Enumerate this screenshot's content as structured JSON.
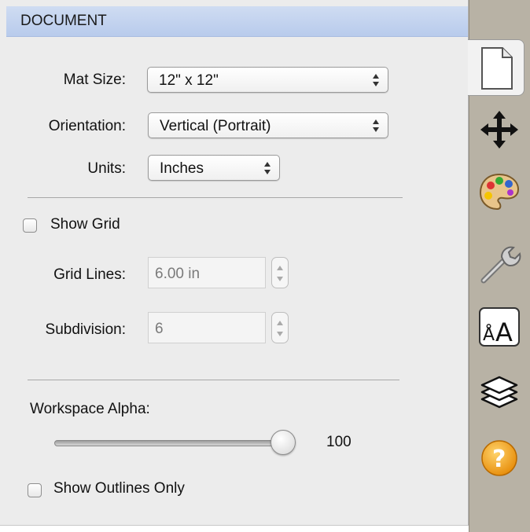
{
  "header": {
    "title": "DOCUMENT"
  },
  "mat_size": {
    "label": "Mat Size:",
    "value": "12\" x 12\""
  },
  "orientation": {
    "label": "Orientation:",
    "value": "Vertical (Portrait)"
  },
  "units": {
    "label": "Units:",
    "value": "Inches"
  },
  "show_grid": {
    "label": "Show Grid",
    "checked": false
  },
  "grid_lines": {
    "label": "Grid Lines:",
    "value": "6.00 in"
  },
  "subdivision": {
    "label": "Subdivision:",
    "value": "6"
  },
  "workspace_alpha": {
    "label": "Workspace Alpha:",
    "value": "100",
    "level": 1.0
  },
  "show_outlines": {
    "label": "Show Outlines Only",
    "checked": false
  },
  "sidebar": {
    "tabs": [
      {
        "name": "document-icon",
        "active": true
      },
      {
        "name": "move-icon",
        "active": false
      },
      {
        "name": "palette-icon",
        "active": false
      },
      {
        "name": "wrench-icon",
        "active": false
      },
      {
        "name": "text-icon",
        "active": false,
        "glyph": "ÅA"
      },
      {
        "name": "layers-icon",
        "active": false
      },
      {
        "name": "help-icon",
        "active": false,
        "glyph": "?"
      }
    ]
  },
  "colors": {
    "header_bg": "#c4d4ef",
    "sidebar_bg": "#b8b2a5",
    "help_orange": "#f5a623"
  }
}
